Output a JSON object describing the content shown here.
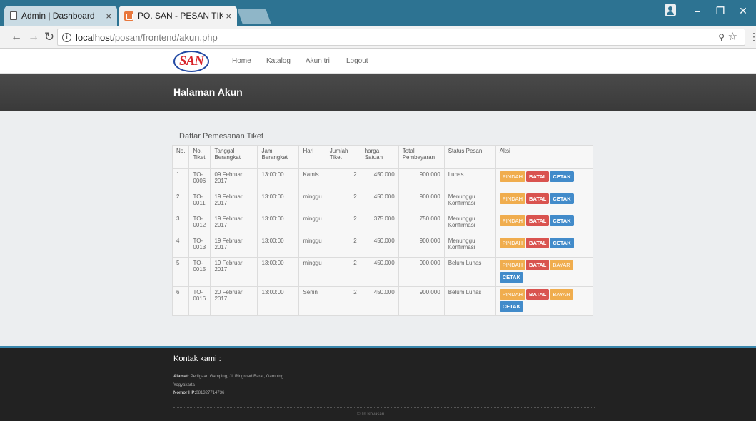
{
  "browser": {
    "tabs": [
      {
        "title": "Admin | Dashboard",
        "close": "×"
      },
      {
        "title": "PO. SAN - PESAN TIKET |",
        "close": "×"
      }
    ],
    "window_controls": {
      "minimize": "–",
      "maximize": "❐",
      "close": "✕"
    },
    "address": {
      "host": "localhost",
      "path": "/posan/frontend/akun.php"
    }
  },
  "site": {
    "logo": "SAN",
    "nav": {
      "home": "Home",
      "katalog": "Katalog",
      "akun": "Akun tri",
      "logout": "Logout"
    },
    "banner_title": "Halaman Akun"
  },
  "orders": {
    "title": "Daftar Pemesanan Tiket",
    "headers": {
      "no": "No.",
      "tiket": [
        "No.",
        "Tiket"
      ],
      "tanggal": [
        "Tanggal",
        "Berangkat"
      ],
      "jam": [
        "Jam",
        "Berangkat"
      ],
      "hari": "Hari",
      "jumlah": [
        "Jumlah",
        "Tiket"
      ],
      "harga": [
        "harga",
        "Satuan"
      ],
      "total": [
        "Total",
        "Pembayaran"
      ],
      "status": "Status Pesan",
      "aksi": "Aksi"
    },
    "rows": [
      {
        "no": "1",
        "tiket": "TO-0006",
        "tanggal": "09 Februari 2017",
        "jam": "13:00:00",
        "hari": "Kamis",
        "jumlah": "2",
        "harga": "450.000",
        "total": "900.000",
        "status": [
          "Lunas"
        ],
        "actions": [
          "PINDAH",
          "BATAL",
          "CETAK"
        ]
      },
      {
        "no": "2",
        "tiket": "TO-0011",
        "tanggal": "19 Februari 2017",
        "jam": "13:00:00",
        "hari": "minggu",
        "jumlah": "2",
        "harga": "450.000",
        "total": "900.000",
        "status": [
          "Menunggu",
          "Konfirmasi"
        ],
        "actions": [
          "PINDAH",
          "BATAL",
          "CETAK"
        ]
      },
      {
        "no": "3",
        "tiket": "TO-0012",
        "tanggal": "19 Februari 2017",
        "jam": "13:00:00",
        "hari": "minggu",
        "jumlah": "2",
        "harga": "375.000",
        "total": "750.000",
        "status": [
          "Menunggu",
          "Konfirmasi"
        ],
        "actions": [
          "PINDAH",
          "BATAL",
          "CETAK"
        ]
      },
      {
        "no": "4",
        "tiket": "TO-0013",
        "tanggal": "19 Februari 2017",
        "jam": "13:00:00",
        "hari": "minggu",
        "jumlah": "2",
        "harga": "450.000",
        "total": "900.000",
        "status": [
          "Menunggu",
          "Konfirmasi"
        ],
        "actions": [
          "PINDAH",
          "BATAL",
          "CETAK"
        ]
      },
      {
        "no": "5",
        "tiket": "TO-0015",
        "tanggal": "19 Februari 2017",
        "jam": "13:00:00",
        "hari": "minggu",
        "jumlah": "2",
        "harga": "450.000",
        "total": "900.000",
        "status": [
          "Belum Lunas"
        ],
        "actions": [
          "PINDAH",
          "BATAL",
          "BAYAR",
          "CETAK"
        ]
      },
      {
        "no": "6",
        "tiket": "TO-0016",
        "tanggal": "20 Februari 2017",
        "jam": "13:00:00",
        "hari": "Senin",
        "jumlah": "2",
        "harga": "450.000",
        "total": "900.000",
        "status": [
          "Belum Lunas"
        ],
        "actions": [
          "PINDAH",
          "BATAL",
          "BAYAR",
          "CETAK"
        ]
      }
    ],
    "action_colors": {
      "PINDAH": "#f0ad4e",
      "BATAL": "#d9534f",
      "BAYAR": "#f0ad4e",
      "CETAK": "#428bca"
    }
  },
  "footer": {
    "title": "Kontak kami :",
    "address_label": "Alamat:",
    "address": "Perligaan Gamping, Jl. Ringroad Barat, Gamping",
    "city": "Yogyakarta",
    "phone_label": "Nomor HP:",
    "phone": "081327714736",
    "copyright": "© Tri Novasari"
  },
  "icons": {
    "tab1": "document-icon",
    "tab2": "site-favicon-icon",
    "back": "back-arrow-icon",
    "forward": "forward-arrow-icon",
    "reload": "reload-icon",
    "info": "info-icon",
    "zoom": "zoom-icon",
    "star": "bookmark-star-icon",
    "menu": "menu-dots-icon",
    "profile": "profile-icon"
  }
}
